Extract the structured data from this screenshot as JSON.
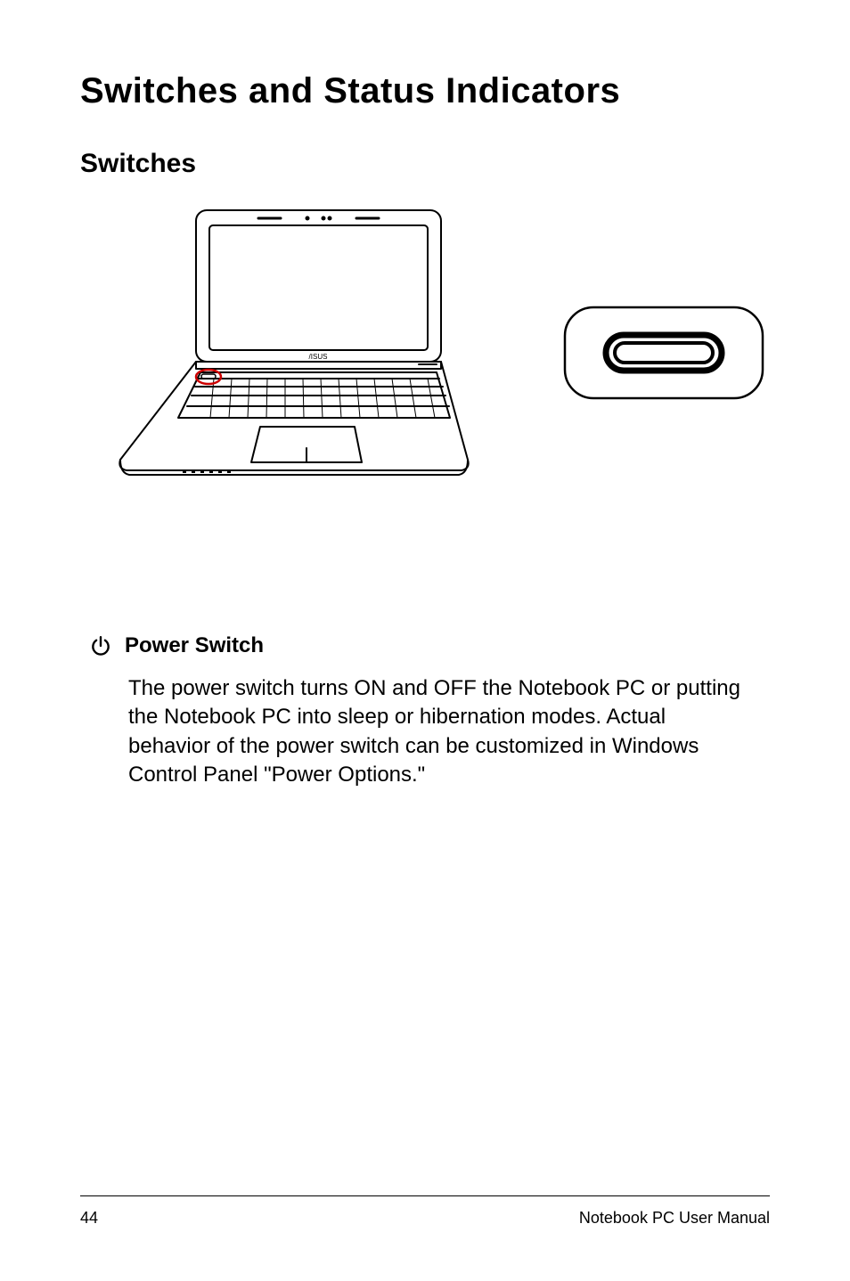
{
  "title": "Switches and Status Indicators",
  "subtitle": "Switches",
  "section": {
    "heading": "Power Switch",
    "body": "The power switch turns ON and OFF the Notebook PC or putting the Notebook PC into sleep or hibernation modes. Actual behavior of the power switch can be customized in Windows Control Panel \"Power Options.\""
  },
  "footer": {
    "page_number": "44",
    "manual_name": "Notebook PC User Manual"
  },
  "icons": {
    "power": "power-icon",
    "laptop_diagram": "laptop-diagram-icon",
    "switch_closeup": "switch-closeup-icon"
  }
}
